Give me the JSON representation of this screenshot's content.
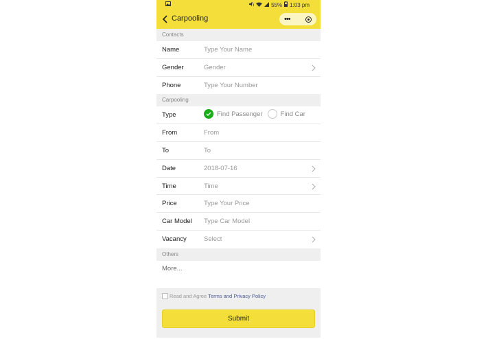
{
  "status": {
    "battery": "55%",
    "time": "1:03 pm"
  },
  "nav": {
    "title": "Carpooling"
  },
  "sections": {
    "contacts": "Contacts",
    "carpooling": "Carpooling",
    "others": "Others"
  },
  "contacts": [
    {
      "label": "Name",
      "value": "Type Your Name"
    },
    {
      "label": "Gender",
      "value": "Gender"
    },
    {
      "label": "Phone",
      "value": "Type Your Number"
    }
  ],
  "type": {
    "label": "Type",
    "option1": "Find Passenger",
    "option2": "Find Car",
    "selected": "Find Passenger"
  },
  "carpooling": [
    {
      "label": "From",
      "value": "From"
    },
    {
      "label": "To",
      "value": "To"
    },
    {
      "label": "Date",
      "value": "2018-07-16"
    },
    {
      "label": "Time",
      "value": "Time"
    },
    {
      "label": "Price",
      "value": "Type Your Price"
    },
    {
      "label": "Car Model",
      "value": "Type Car Model"
    },
    {
      "label": "Vacancy",
      "value": "Select"
    }
  ],
  "others": {
    "more": "More..."
  },
  "footer": {
    "agree_text": "Read and Agree",
    "link_text": "Terms and Privacy Policy",
    "submit": "Submit"
  },
  "colors": {
    "accent": "#f4de3a",
    "check": "#1aad19"
  }
}
